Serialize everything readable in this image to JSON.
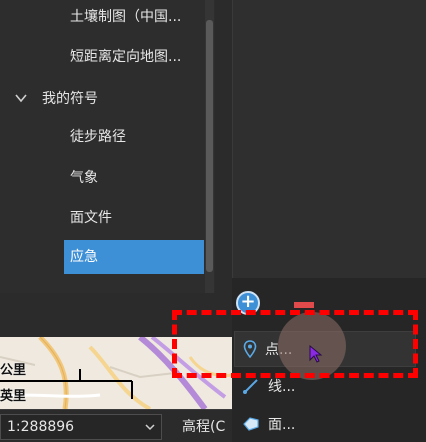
{
  "symbol_tree": {
    "items": [
      {
        "label": "土壤制图（中国..."
      },
      {
        "label": "短距离定向地图..."
      }
    ],
    "group": {
      "label": "我的符号",
      "expanded": true
    },
    "children": [
      {
        "label": "徒步路径"
      },
      {
        "label": "气象"
      },
      {
        "label": "面文件"
      },
      {
        "label": "应急",
        "selected": true
      }
    ]
  },
  "add_menu": {
    "add_icon": "plus-icon",
    "items": [
      {
        "label": "点...",
        "icon": "map-pin-icon"
      },
      {
        "label": "线...",
        "icon": "line-icon"
      },
      {
        "label": "面...",
        "icon": "polygon-icon"
      }
    ]
  },
  "map": {
    "scalebar_top_label": "公里",
    "scalebar_bottom_label": "英里"
  },
  "status_bar": {
    "scale_value": "1:288896",
    "elevation_label": "高程(C"
  },
  "colors": {
    "selected": "#3d8fd6",
    "annotation": "#ff0000",
    "panel": "#2d2d2d"
  }
}
